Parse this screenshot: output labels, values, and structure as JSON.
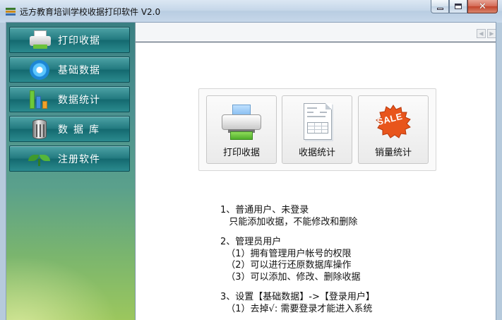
{
  "window": {
    "title": "远方教育培训学校收据打印软件 V2.0",
    "controls": {
      "minimize": "minimize",
      "maximize": "maximize",
      "close": "✕"
    }
  },
  "sidebar": {
    "items": [
      {
        "label": "打印收据",
        "icon": "printer-icon"
      },
      {
        "label": "基础数据",
        "icon": "gear-icon"
      },
      {
        "label": "数据统计",
        "icon": "bar-chart-icon"
      },
      {
        "label": "数据库",
        "icon": "database-icon"
      },
      {
        "label": "注册软件",
        "icon": "sprout-icon"
      }
    ]
  },
  "main": {
    "scroll": {
      "left": "◀",
      "right": "▶"
    },
    "cards": [
      {
        "label": "打印收据",
        "icon": "printer-icon"
      },
      {
        "label": "收据统计",
        "icon": "document-icon"
      },
      {
        "label": "销量统计",
        "icon": "sale-badge-icon",
        "badge_text": "SALE"
      }
    ],
    "notes": {
      "s1": "1、普通用户、未登录",
      "s1_l1": "   只能添加收据，不能修改和删除",
      "s2": "2、管理员用户",
      "s2_l1": "  （1）拥有管理用户帐号的权限",
      "s2_l2": "  （2）可以进行还原数据库操作",
      "s2_l3": "  （3）可以添加、修改、删除收据",
      "s3": "3、设置【基础数据】->【登录用户】",
      "s3_l1": "  （1）去掉√: 需要登录才能进入系统"
    }
  },
  "colors": {
    "sidebar_button": "#237a80",
    "sale_badge": "#e8551c",
    "tray_green": "#4fae2a"
  }
}
